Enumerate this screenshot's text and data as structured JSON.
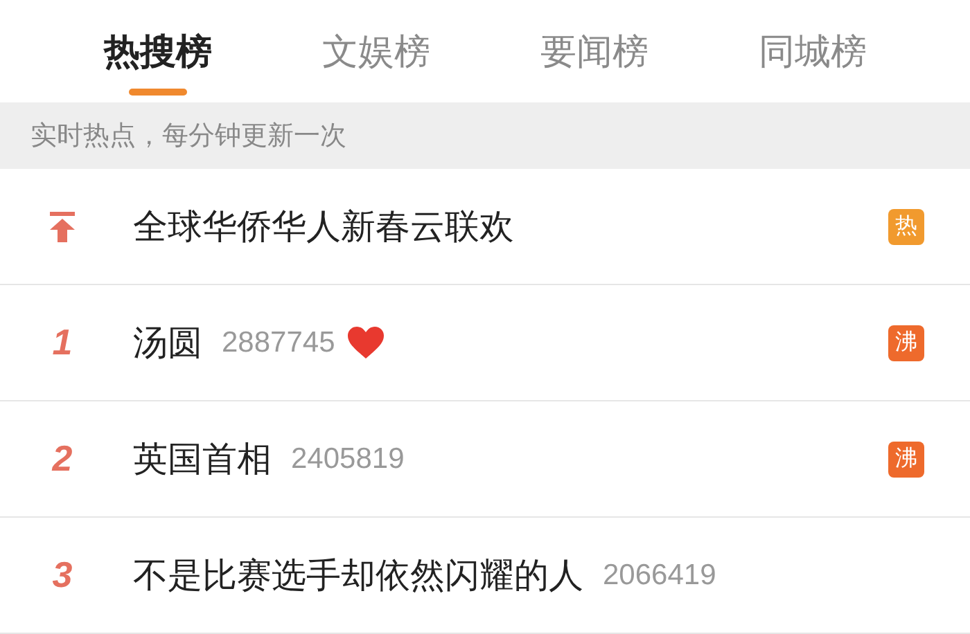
{
  "tabs": [
    {
      "label": "热搜榜",
      "selected": true
    },
    {
      "label": "文娱榜",
      "selected": false
    },
    {
      "label": "要闻榜",
      "selected": false
    },
    {
      "label": "同城榜",
      "selected": false
    }
  ],
  "banner": "实时热点，每分钟更新一次",
  "rows": [
    {
      "kind": "pinned",
      "title": "全球华侨华人新春云联欢",
      "heart": false,
      "badge": {
        "label": "热",
        "color": "#f19a2e"
      }
    },
    {
      "kind": "ranked",
      "rank": "1",
      "title": "汤圆",
      "count": "2887745",
      "heart": true,
      "badge": {
        "label": "沸",
        "color": "#ee6a2c"
      }
    },
    {
      "kind": "ranked",
      "rank": "2",
      "title": "英国首相",
      "count": "2405819",
      "heart": false,
      "badge": {
        "label": "沸",
        "color": "#ee6a2c"
      }
    },
    {
      "kind": "ranked",
      "rank": "3",
      "title": "不是比赛选手却依然闪耀的人",
      "count": "2066419",
      "heart": false
    }
  ]
}
